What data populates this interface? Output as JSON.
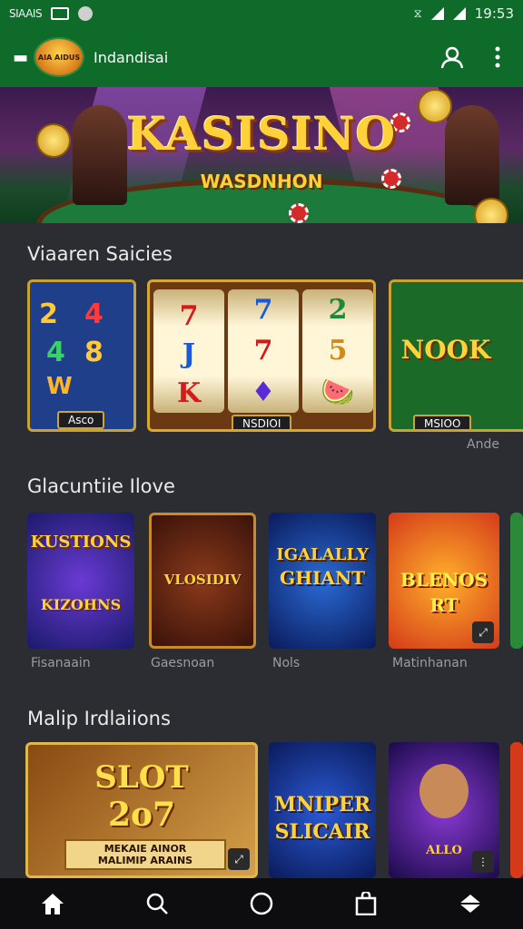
{
  "status_bar": {
    "left_text": "SIAAIS",
    "time": "19:53"
  },
  "app_bar": {
    "logo_text": "AIA AIDUS",
    "title": "Indandisai",
    "back_icon": "back-arrow-icon",
    "account_icon": "user-icon",
    "menu_icon": "more-vert-icon"
  },
  "hero": {
    "title": "KASISINO",
    "subtitle": "WASDNHON"
  },
  "sections": [
    {
      "title": "Viaaren Saicies",
      "more_label": "Ande",
      "tiles": [
        {
          "badge": "Asco",
          "symbols": [
            "2",
            "4",
            "8",
            "W"
          ]
        },
        {
          "badge": "NSDIOI",
          "reels": [
            [
              "7",
              "J",
              "K"
            ],
            [
              "7",
              "7",
              "♦"
            ],
            [
              "2",
              "5",
              "🍉"
            ]
          ]
        },
        {
          "badge": "MSIOO",
          "art_text": "NOOK"
        }
      ]
    },
    {
      "title": "Glacuntiie Ilove",
      "tiles": [
        {
          "art_text": "KUSTIONS",
          "art_sub": "KIZOHNS",
          "label": "Fisanaain"
        },
        {
          "art_text": "VLOSIDIV",
          "label": "Gaesnoan"
        },
        {
          "art_text": "IGALALLY",
          "art_sub": "GHIANT",
          "label": "Nols"
        },
        {
          "art_text": "BLENOS",
          "art_sub": "RT",
          "label": "Matinhanan"
        }
      ]
    },
    {
      "title": "Malip Irdlaiions",
      "tiles": [
        {
          "art_text": "SLOT",
          "art_sub": "2o7",
          "banner": "MEKAIE AINOR\nMALIMIP ARAINS"
        },
        {
          "art_text": "MNIPER",
          "art_sub": "SLICAIR"
        },
        {
          "art_text": "ALLO"
        }
      ]
    }
  ],
  "nav": [
    "home-icon",
    "search-icon",
    "circle-home-icon",
    "bag-icon",
    "diamond-icon"
  ],
  "colors": {
    "brand_green": "#0f6b2a",
    "background": "#2b2d33",
    "gold": "#ffd23a"
  }
}
